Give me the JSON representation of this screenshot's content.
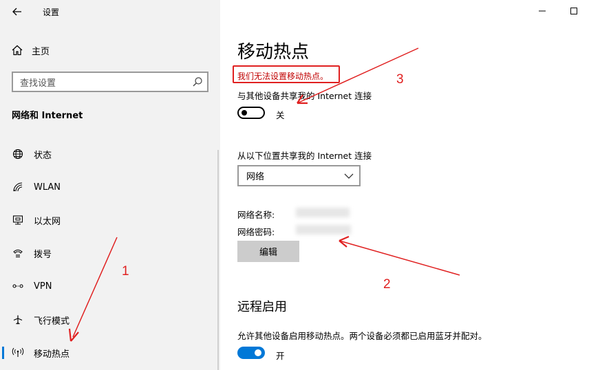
{
  "window": {
    "title": "设置"
  },
  "sidebar": {
    "home_label": "主页",
    "search_placeholder": "查找设置",
    "section_title": "网络和 Internet",
    "items": [
      {
        "label": "状态",
        "icon": "globe-icon"
      },
      {
        "label": "WLAN",
        "icon": "wifi-icon"
      },
      {
        "label": "以太网",
        "icon": "ethernet-icon"
      },
      {
        "label": "拨号",
        "icon": "dialup-icon"
      },
      {
        "label": "VPN",
        "icon": "vpn-icon"
      },
      {
        "label": "飞行模式",
        "icon": "airplane-icon"
      },
      {
        "label": "移动热点",
        "icon": "hotspot-icon",
        "active": true
      }
    ]
  },
  "main": {
    "title": "移动热点",
    "error": "我们无法设置移动热点。",
    "share_label": "与其他设备共享我的 Internet 连接",
    "share_toggle": {
      "state": "关",
      "on": false
    },
    "from_label": "从以下位置共享我的 Internet 连接",
    "from_select": "网络",
    "network_name_label": "网络名称:",
    "network_password_label": "网络密码:",
    "edit_button": "编辑",
    "remote_title": "远程启用",
    "remote_desc": "允许其他设备启用移动热点。两个设备必须都已启用蓝牙并配对。",
    "remote_toggle": {
      "state": "开",
      "on": true
    }
  },
  "annotations": {
    "color": "#e02020",
    "labels": [
      "1",
      "2",
      "3"
    ]
  },
  "colors": {
    "accent": "#0078d7",
    "sidebar_bg": "#f2f2f2",
    "error": "#c00000"
  }
}
